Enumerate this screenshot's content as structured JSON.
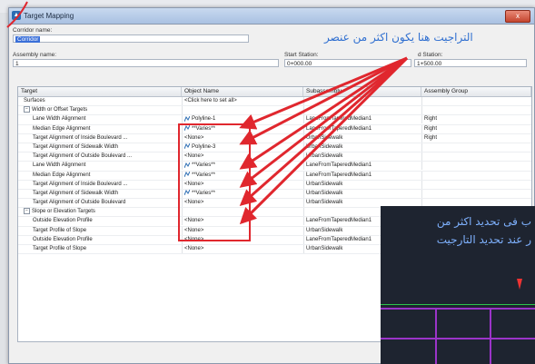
{
  "dialog": {
    "title": "Target Mapping",
    "close_glyph": "x"
  },
  "corridor": {
    "label": "Corridor name:",
    "value": "Corridor"
  },
  "assembly": {
    "label": "Assembly name:",
    "value": "1"
  },
  "stations": {
    "start_label": "Start Station:",
    "start_value": "0+000.00",
    "end_label": "d Station:",
    "end_value": "1+500.00"
  },
  "grid": {
    "headers": [
      "Target",
      "Object Name",
      "Subassembly",
      "Assembly Group"
    ],
    "rows": [
      {
        "target": "Surfaces",
        "object": "<Click here to set all>",
        "sub": "",
        "asm": "",
        "level": 1
      },
      {
        "target": "Width or Offset Targets",
        "object": "",
        "sub": "",
        "asm": "",
        "level": 1,
        "toggle": "−"
      },
      {
        "target": "Lane Width Alignment",
        "object": "Polyline-1",
        "sub": "LaneFromTaperedMedian1",
        "asm": "Right",
        "level": 2,
        "icon": true
      },
      {
        "target": "Median Edge Alignment",
        "object": "**Varies**",
        "sub": "LaneFromTaperedMedian1",
        "asm": "Right",
        "level": 2,
        "icon": true
      },
      {
        "target": "Target Alignment of Inside Boulevard ...",
        "object": "<None>",
        "sub": "UrbanSidewalk",
        "asm": "Right",
        "level": 2
      },
      {
        "target": "Target Alignment of Sidewalk Width",
        "object": "Polyline-3",
        "sub": "UrbanSidewalk",
        "asm": "",
        "level": 2,
        "icon": true
      },
      {
        "target": "Target Alignment of Outside Boulevard ...",
        "object": "<None>",
        "sub": "UrbanSidewalk",
        "asm": "",
        "level": 2
      },
      {
        "target": "Lane Width Alignment",
        "object": "**Varies**",
        "sub": "LaneFromTaperedMedian1",
        "asm": "",
        "level": 2,
        "icon": true
      },
      {
        "target": "Median Edge Alignment",
        "object": "**Varies**",
        "sub": "LaneFromTaperedMedian1",
        "asm": "",
        "level": 2,
        "icon": true
      },
      {
        "target": "Target Alignment of Inside Boulevard ...",
        "object": "<None>",
        "sub": "UrbanSidewalk",
        "asm": "",
        "level": 2
      },
      {
        "target": "Target Alignment of Sidewalk Width",
        "object": "**Varies**",
        "sub": "UrbanSidewalk",
        "asm": "",
        "level": 2,
        "icon": true
      },
      {
        "target": "Target Alignment of Outside Boulevard",
        "object": "<None>",
        "sub": "UrbanSidewalk",
        "asm": "",
        "level": 2
      },
      {
        "target": "Slope or Elevation Targets",
        "object": "",
        "sub": "",
        "asm": "",
        "level": 1,
        "toggle": "−"
      },
      {
        "target": "Outside Elevation Profile",
        "object": "<None>",
        "sub": "LaneFromTaperedMedian1",
        "asm": "",
        "level": 2
      },
      {
        "target": "Target Profile of Slope",
        "object": "<None>",
        "sub": "UrbanSidewalk",
        "asm": "",
        "level": 2
      },
      {
        "target": "Outside Elevation Profile",
        "object": "<None>",
        "sub": "LaneFromTaperedMedian1",
        "asm": "",
        "level": 2
      },
      {
        "target": "Target Profile of Slope",
        "object": "<None>",
        "sub": "UrbanSidewalk",
        "asm": "",
        "level": 2
      }
    ]
  },
  "annotations": {
    "arabic_top": "التراجيت هنا يكون اكثر من عنصر",
    "cad_line1": "ب فى تحديد اكثر من",
    "cad_line2": "ر عند تحديد التارجيت"
  },
  "colors": {
    "highlight": "#e0272e",
    "note_blue": "#2f6fd0",
    "cad_bg": "#1e2430",
    "cad_purple": "#9b34c9"
  }
}
